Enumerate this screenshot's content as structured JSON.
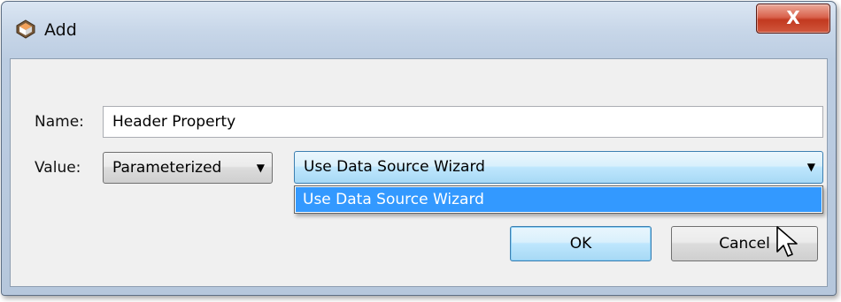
{
  "window": {
    "title": "Add",
    "app_icon": "app-logo-icon",
    "close_label": "X"
  },
  "form": {
    "name_label": "Name:",
    "name_value": "Header Property",
    "value_label": "Value:",
    "value_type": {
      "selected": "Parameterized"
    },
    "data_source": {
      "selected": "Use Data Source Wizard",
      "expanded": true,
      "options": [
        "Use Data Source Wizard"
      ],
      "highlighted_index": 0
    }
  },
  "buttons": {
    "ok": "OK",
    "cancel": "Cancel"
  },
  "colors": {
    "highlight": "#3399ff",
    "close_button": "#c2391f",
    "title_gradient": "#c7d6e8"
  },
  "icons": {
    "dropdown_arrow": "▼",
    "cursor": "mouse-pointer-icon"
  }
}
